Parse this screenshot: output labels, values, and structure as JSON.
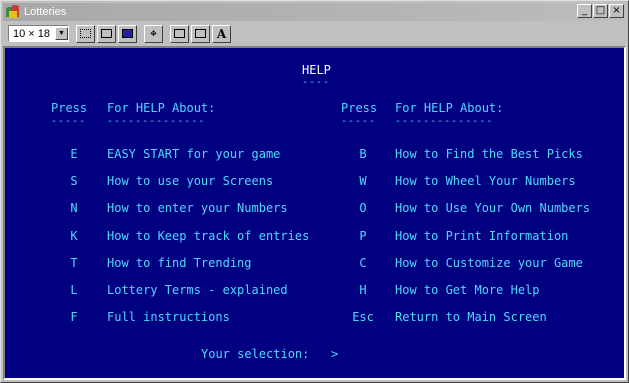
{
  "window": {
    "title": "Lotteries",
    "controls": [
      "_",
      "□",
      "×"
    ]
  },
  "toolbar": {
    "font_size": "10 × 18"
  },
  "help": {
    "title": "HELP",
    "col_press": "Press",
    "col_about": "For HELP About:",
    "left": [
      {
        "key": "E",
        "text": "EASY START for your game"
      },
      {
        "key": "S",
        "text": "How to use your Screens"
      },
      {
        "key": "N",
        "text": "How to enter your Numbers"
      },
      {
        "key": "K",
        "text": "How to Keep track of entries"
      },
      {
        "key": "T",
        "text": "How to find Trending"
      },
      {
        "key": "L",
        "text": "Lottery Terms - explained"
      },
      {
        "key": "F",
        "text": "Full instructions"
      }
    ],
    "right": [
      {
        "key": "B",
        "text": "How to Find the Best Picks"
      },
      {
        "key": "W",
        "text": "How to Wheel Your Numbers"
      },
      {
        "key": "O",
        "text": "How to Use Your Own Numbers"
      },
      {
        "key": "P",
        "text": "How to Print Information"
      },
      {
        "key": "C",
        "text": "How to Customize your Game"
      },
      {
        "key": "H",
        "text": "How to Get More Help"
      },
      {
        "key": "Esc",
        "text": "Return to Main Screen"
      }
    ],
    "prompt": "Your selection:",
    "cursor": ">"
  },
  "colors": {
    "screen_bg": "#000080",
    "text": "#4fd8ff",
    "title": "#ffffff"
  }
}
